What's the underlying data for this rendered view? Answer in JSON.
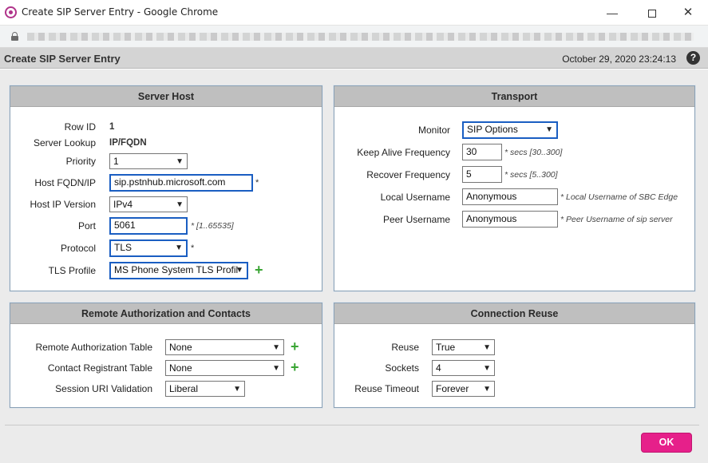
{
  "window": {
    "title": "Create SIP Server Entry - Google Chrome"
  },
  "header": {
    "title": "Create SIP Server Entry",
    "datetime": "October 29, 2020 23:24:13",
    "help": "?"
  },
  "server_host": {
    "title": "Server Host",
    "row_id": {
      "label": "Row ID",
      "value": "1"
    },
    "server_lookup": {
      "label": "Server Lookup",
      "value": "IP/FQDN"
    },
    "priority": {
      "label": "Priority",
      "value": "1"
    },
    "host_fqdn": {
      "label": "Host FQDN/IP",
      "value": "sip.pstnhub.microsoft.com",
      "required": "*"
    },
    "host_ip_version": {
      "label": "Host IP Version",
      "value": "IPv4"
    },
    "port": {
      "label": "Port",
      "value": "5061",
      "hint": "* [1..65535]"
    },
    "protocol": {
      "label": "Protocol",
      "value": "TLS",
      "required": "*"
    },
    "tls_profile": {
      "label": "TLS Profile",
      "value": "MS Phone System TLS Profil"
    }
  },
  "transport": {
    "title": "Transport",
    "monitor": {
      "label": "Monitor",
      "value": "SIP Options"
    },
    "keep_alive": {
      "label": "Keep Alive Frequency",
      "value": "30",
      "hint": "* secs [30..300]"
    },
    "recover": {
      "label": "Recover Frequency",
      "value": "5",
      "hint": "* secs [5..300]"
    },
    "local_username": {
      "label": "Local Username",
      "value": "Anonymous",
      "hint": "* Local Username of SBC Edge"
    },
    "peer_username": {
      "label": "Peer Username",
      "value": "Anonymous",
      "hint": "* Peer Username of sip server"
    }
  },
  "remote_auth": {
    "title": "Remote Authorization and Contacts",
    "auth_table": {
      "label": "Remote Authorization Table",
      "value": "None"
    },
    "contact_table": {
      "label": "Contact Registrant Table",
      "value": "None"
    },
    "session_uri": {
      "label": "Session URI Validation",
      "value": "Liberal"
    }
  },
  "connection_reuse": {
    "title": "Connection Reuse",
    "reuse": {
      "label": "Reuse",
      "value": "True"
    },
    "sockets": {
      "label": "Sockets",
      "value": "4"
    },
    "reuse_timeout": {
      "label": "Reuse Timeout",
      "value": "Forever"
    }
  },
  "footer": {
    "ok_label": "OK"
  },
  "icons": {
    "plus": "+",
    "dropdown": "▼",
    "minimize": "—",
    "close": "✕"
  },
  "colors": {
    "accent": "#e6208a",
    "focus": "#1a5ec2",
    "add": "#3aa534"
  }
}
